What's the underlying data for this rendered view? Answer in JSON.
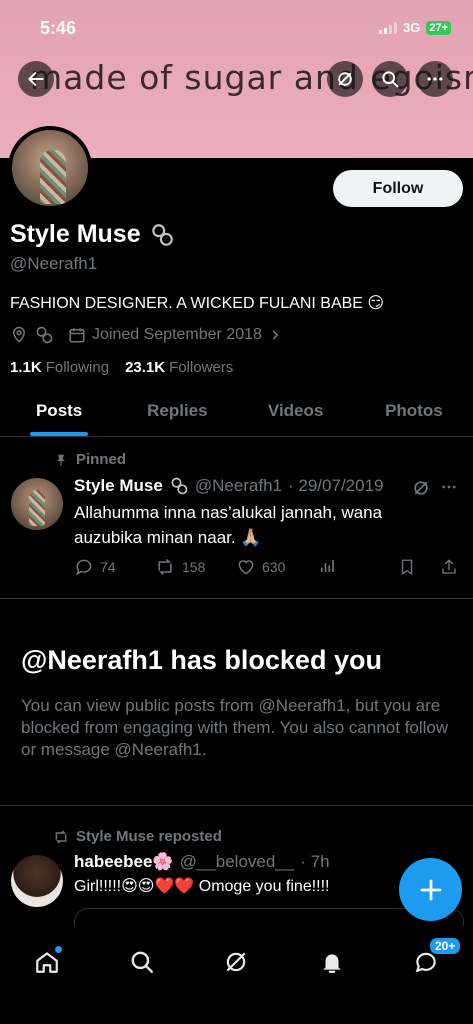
{
  "status_bar": {
    "time": "5:46",
    "network": "3G",
    "battery": "27+"
  },
  "banner": {
    "text": "made of sugar and egoism."
  },
  "profile": {
    "name": "Style Muse",
    "handle": "@Neerafh1",
    "follow_label": "Follow",
    "bio": "FASHION DESIGNER. A WICKED FULANI BABE 😏",
    "joined": "Joined September 2018",
    "following_count": "1.1K",
    "following_label": "Following",
    "followers_count": "23.1K",
    "followers_label": "Followers"
  },
  "tabs": [
    {
      "label": "Posts",
      "active": true
    },
    {
      "label": "Replies"
    },
    {
      "label": "Videos"
    },
    {
      "label": "Photos"
    }
  ],
  "pinned_post": {
    "pinned_label": "Pinned",
    "author_name": "Style Muse",
    "author_handle": "@Neerafh1",
    "date": "· 29/07/2019",
    "text": "Allahumma inna nas’alukal  jannah, wana auzubika minan naar. 🙏🏼",
    "replies": "74",
    "reposts": "158",
    "likes": "630"
  },
  "blocked": {
    "title": "@Neerafh1 has blocked you",
    "text": "You can view public posts from @Neerafh1, but you are blocked from engaging with them. You also cannot follow or message @Neerafh1."
  },
  "repost": {
    "reposted_label": "Style Muse  reposted",
    "author_name": "habeebee🌸",
    "author_handle": "@__beloved__",
    "time": "· 7h",
    "text": "Girl!!!!!😍😍❤️❤️ Omoge you fine!!!!"
  },
  "nav": {
    "messages_badge": "20+"
  },
  "colors": {
    "accent": "#1d9bf0",
    "background": "#000000",
    "muted": "#71767b"
  }
}
